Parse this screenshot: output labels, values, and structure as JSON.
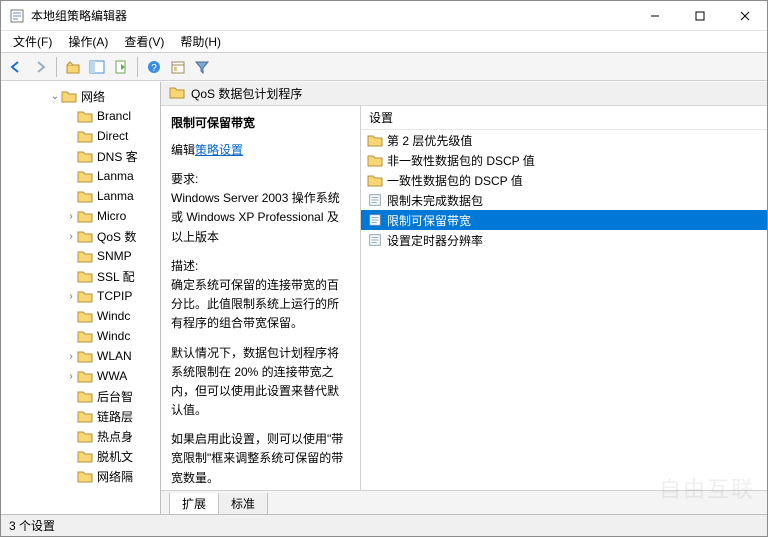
{
  "window": {
    "title": "本地组策略编辑器"
  },
  "menu": {
    "file": "文件(F)",
    "action": "操作(A)",
    "view": "查看(V)",
    "help": "帮助(H)"
  },
  "toolbar_icons": {
    "back": "back-arrow",
    "forward": "forward-arrow",
    "up": "up-folder",
    "show_tree": "show-tree",
    "export": "export-list",
    "help": "help",
    "properties": "properties",
    "filter": "filter"
  },
  "tree": {
    "root": "网络",
    "items": [
      {
        "label": "Brancl",
        "expandable": false
      },
      {
        "label": "Direct",
        "expandable": false
      },
      {
        "label": "DNS 客",
        "expandable": false
      },
      {
        "label": "Lanma",
        "expandable": false
      },
      {
        "label": "Lanma",
        "expandable": false
      },
      {
        "label": "Micro",
        "expandable": true
      },
      {
        "label": "QoS 数",
        "expandable": true
      },
      {
        "label": "SNMP",
        "expandable": false
      },
      {
        "label": "SSL 配",
        "expandable": false
      },
      {
        "label": "TCPIP",
        "expandable": true
      },
      {
        "label": "Windc",
        "expandable": false
      },
      {
        "label": "Windc",
        "expandable": false
      },
      {
        "label": "WLAN",
        "expandable": true
      },
      {
        "label": "WWA",
        "expandable": true
      },
      {
        "label": "后台智",
        "expandable": false
      },
      {
        "label": "链路层",
        "expandable": false
      },
      {
        "label": "热点身",
        "expandable": false
      },
      {
        "label": "脱机文",
        "expandable": false
      },
      {
        "label": "网络隔",
        "expandable": false
      }
    ]
  },
  "breadcrumb": {
    "label": "QoS 数据包计划程序"
  },
  "desc": {
    "title": "限制可保留带宽",
    "edit_prefix": "编辑",
    "edit_link": "策略设置",
    "req_label": "要求:",
    "req_body": "Windows Server 2003 操作系统或 Windows XP Professional 及以上版本",
    "desc_label": "描述:",
    "p1": "确定系统可保留的连接带宽的百分比。此值限制系统上运行的所有程序的组合带宽保留。",
    "p2": "默认情况下，数据包计划程序将系统限制在 20% 的连接带宽之内，但可以使用此设置来替代默认值。",
    "p3": "如果启用此设置，则可以使用\"带宽限制\"框来调整系统可保留的带宽数量。"
  },
  "list": {
    "header": "设置",
    "rows": [
      {
        "icon": "folder",
        "label": "第 2 层优先级值"
      },
      {
        "icon": "folder",
        "label": "非一致性数据包的 DSCP 值"
      },
      {
        "icon": "folder",
        "label": "一致性数据包的 DSCP 值"
      },
      {
        "icon": "setting",
        "label": "限制未完成数据包"
      },
      {
        "icon": "setting",
        "label": "限制可保留带宽",
        "selected": true
      },
      {
        "icon": "setting",
        "label": "设置定时器分辨率"
      }
    ]
  },
  "tabs": {
    "extended": "扩展",
    "standard": "标准"
  },
  "status": {
    "text": "3 个设置"
  },
  "watermark": "自由互联"
}
